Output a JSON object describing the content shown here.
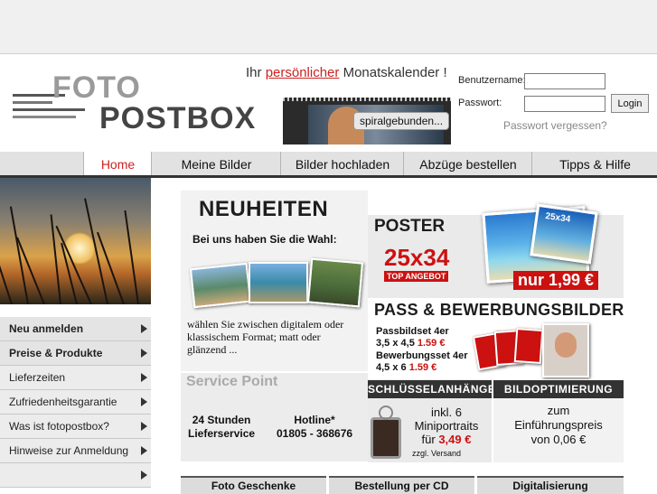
{
  "header": {
    "logo_top": "FOTO",
    "logo_bottom": "POSTBOX",
    "promo_prefix": "Ihr ",
    "promo_highlight": "persönlicher",
    "promo_suffix": " Monatskalender !",
    "calendar_tag": "spiralgebunden...",
    "login": {
      "username_label": "Benutzername:",
      "password_label": "Passwort:",
      "login_button": "Login",
      "forgot_link": "Passwort vergessen?"
    }
  },
  "nav": {
    "items": [
      {
        "label": "Home",
        "active": true
      },
      {
        "label": "Meine Bilder"
      },
      {
        "label": "Bilder hochladen"
      },
      {
        "label": "Abzüge bestellen"
      },
      {
        "label": "Tipps & Hilfe"
      }
    ]
  },
  "sidebar": {
    "items": [
      {
        "label": "Neu anmelden"
      },
      {
        "label": "Preise & Produkte"
      },
      {
        "label": "Lieferzeiten"
      },
      {
        "label": "Zufriedenheitsgarantie"
      },
      {
        "label": "Was ist fotopostbox?"
      },
      {
        "label": "Hinweise zur Anmeldung"
      },
      {
        "label": ""
      }
    ]
  },
  "neuheiten": {
    "title": "NEUHEITEN",
    "subtitle": "Bei uns haben Sie die Wahl:",
    "text": "wählen Sie zwischen digitalem oder klassischem Format; matt oder glänzend ..."
  },
  "service": {
    "title": "Service Point",
    "delivery_line1": "24 Stunden",
    "delivery_line2": "Lieferservice",
    "hotline_line1": "Hotline*",
    "hotline_line2": "01805 - 368676"
  },
  "poster": {
    "title": "POSTER",
    "size": "25x34",
    "badge": "TOP ANGEBOT",
    "image_label": "25x34",
    "price": "nur 1,99 €"
  },
  "pass": {
    "title": "PASS & BEWERBUNGSBILDER",
    "line1": "Passbildset 4er",
    "line2_prefix": "3,5 x 4,5 ",
    "line2_price": "1.59 €",
    "line3": "Bewerbungsset 4er",
    "line4_prefix": "4,5 x 6 ",
    "line4_price": "1.59 €"
  },
  "keychain": {
    "title": "SCHLÜSSELANHÄNGER",
    "line1": "inkl. 6",
    "line2": "Miniportraits",
    "line3_prefix": "für ",
    "line3_price": "3,49 €",
    "note": "zzgl. Versand"
  },
  "optimize": {
    "title": "BILDOPTIMIERUNG",
    "line1": "zum",
    "line2": "Einführungspreis",
    "line3": "von 0,06 €"
  },
  "bottom_tabs": [
    {
      "label": "Foto Geschenke"
    },
    {
      "label": "Bestellung per CD"
    },
    {
      "label": "Digitalisierung"
    }
  ],
  "colors": {
    "accent_red": "#cc2222",
    "nav_bar": "#e2e2e2",
    "nav_underline": "#333333"
  }
}
